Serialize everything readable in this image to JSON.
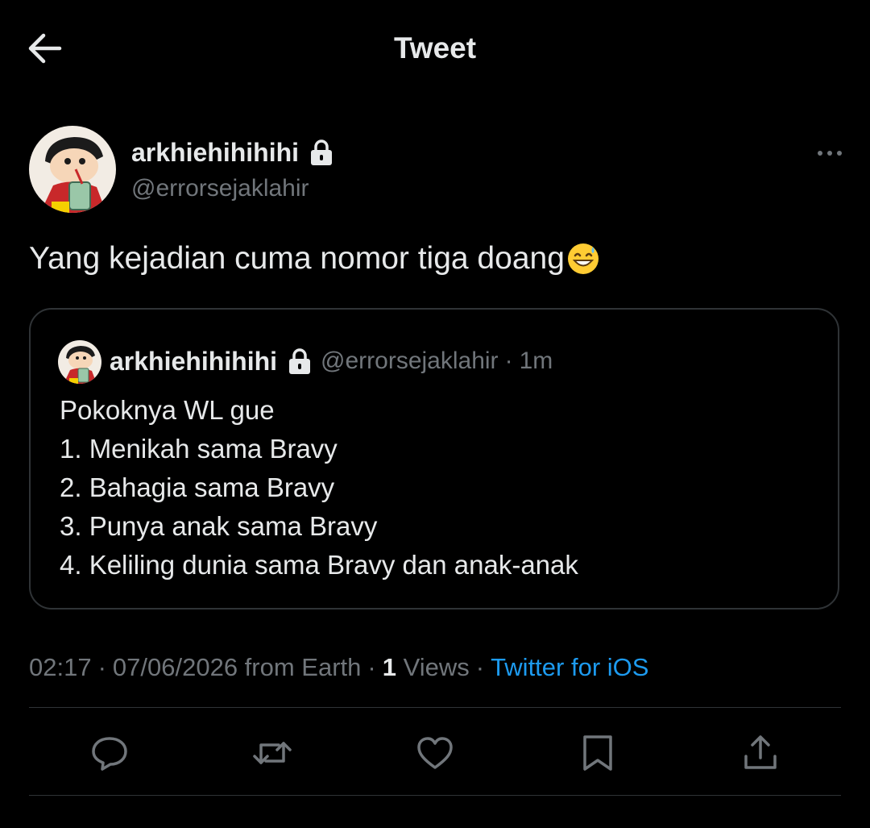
{
  "header": {
    "title": "Tweet",
    "back_icon": "arrow-left-icon"
  },
  "tweet": {
    "author_name": "arkhiehihihihi",
    "author_handle": "@errorsejaklahir",
    "protected_icon": "lock-icon",
    "more_icon": "more-horizontal-icon",
    "text": "Yang kejadian cuma nomor tiga doang",
    "emoji": "grinning-face-with-sweat-emoji"
  },
  "quote": {
    "author_name": "arkhiehihihihi",
    "author_handle": "@errorsejaklahir",
    "dot": "·",
    "time": "1m",
    "lines": [
      "Pokoknya WL gue",
      "1. Menikah sama Bravy",
      "2. Bahagia sama Bravy",
      "3. Punya anak sama Bravy",
      "4. Keliling dunia sama Bravy dan anak-anak"
    ]
  },
  "meta": {
    "time": "02:17",
    "dot": "·",
    "date_location": "07/06/2026 from Earth",
    "views_count": "1",
    "views_label": "Views",
    "source": "Twitter for iOS"
  },
  "actions": [
    "reply-icon",
    "retweet-icon",
    "like-icon",
    "bookmark-icon",
    "share-icon"
  ],
  "colors": {
    "background": "#000000",
    "text": "#e7e9ea",
    "secondary": "#71767b",
    "link": "#1d9bf0",
    "border": "#2f3336"
  }
}
